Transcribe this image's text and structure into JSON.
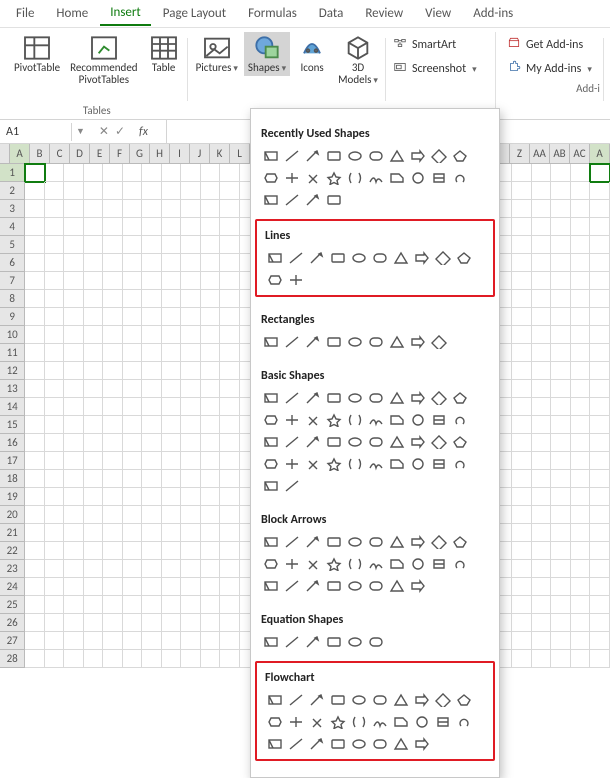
{
  "tabs": [
    "File",
    "Home",
    "Insert",
    "Page Layout",
    "Formulas",
    "Data",
    "Review",
    "View",
    "Add-ins"
  ],
  "active_tab": "Insert",
  "ribbon": {
    "tables": {
      "pivottable": "PivotTable",
      "recommended": "Recommended\nPivotTables",
      "table": "Table",
      "group": "Tables"
    },
    "illustrations": {
      "pictures": "Pictures",
      "shapes": "Shapes",
      "icons": "Icons",
      "models": "3D\nModels"
    },
    "addins_side": {
      "smartart": "SmartArt",
      "screenshot": "Screenshot",
      "get_addins": "Get Add-ins",
      "my_addins": "My Add-ins",
      "group": "Add-i"
    }
  },
  "formula_bar": {
    "cell_ref": "A1"
  },
  "columns": [
    "A",
    "B",
    "C",
    "D",
    "E",
    "F",
    "G",
    "H",
    "I",
    "J",
    "K",
    "L",
    "",
    "",
    "",
    "",
    "",
    "",
    "",
    "",
    "",
    "",
    "",
    "",
    "",
    "Z",
    "AA",
    "AB",
    "AC",
    "A"
  ],
  "selected_col": "A",
  "row_count": 28,
  "selected_row": 1,
  "dropdown": {
    "recently_used": "Recently Used Shapes",
    "lines": "Lines",
    "rectangles": "Rectangles",
    "basic": "Basic Shapes",
    "block": "Block Arrows",
    "equation": "Equation Shapes",
    "flowchart": "Flowchart",
    "counts": {
      "recent": 18,
      "recent2": 6,
      "lines": 12,
      "rect": 9,
      "basic": 42,
      "block": 28,
      "equation": 6,
      "flowchart": 28
    }
  }
}
